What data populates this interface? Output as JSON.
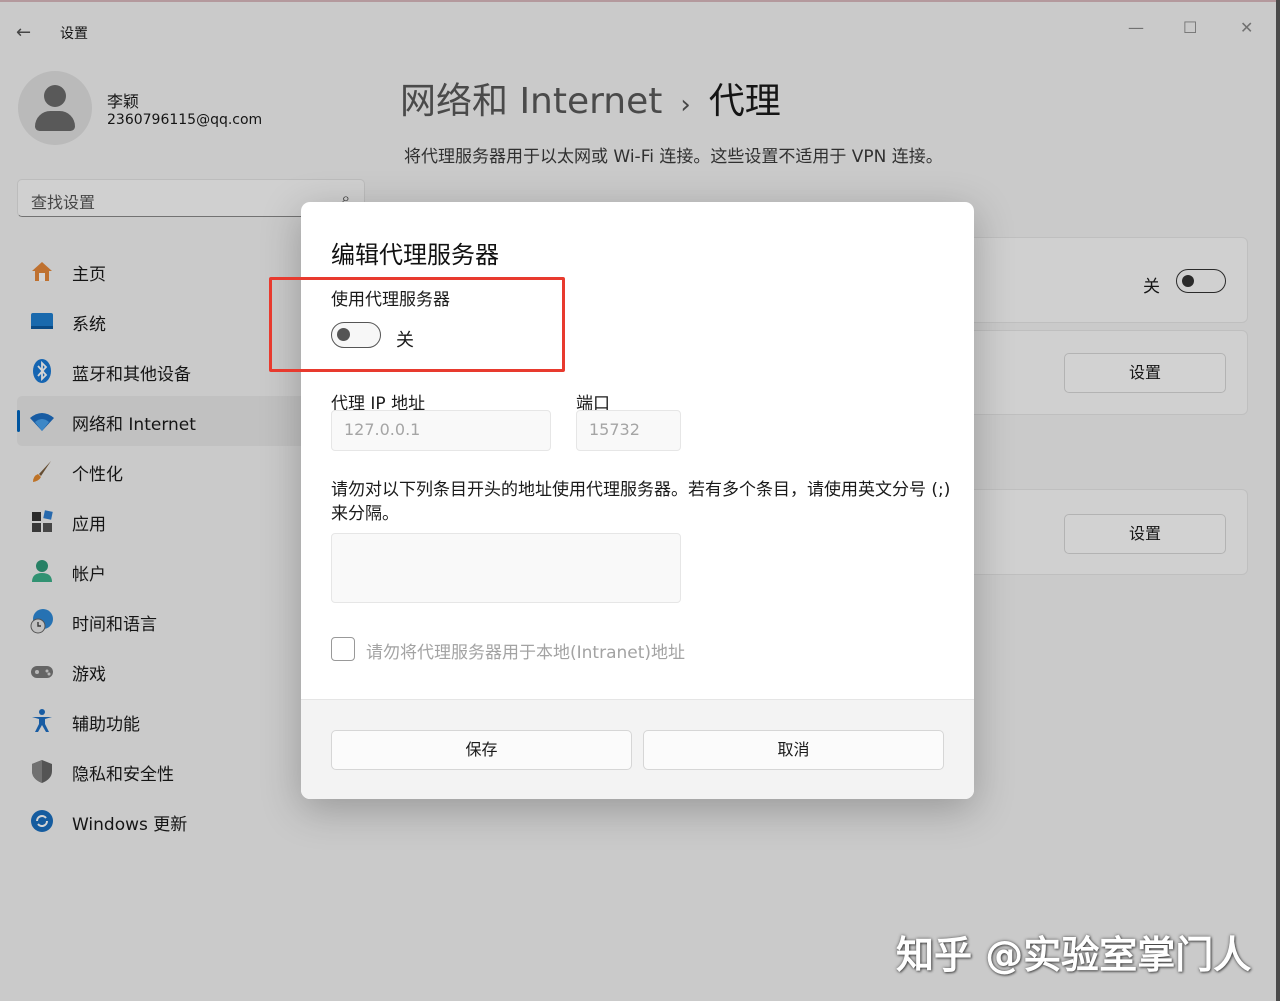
{
  "window": {
    "title": "设置",
    "back_icon": "←",
    "minimize": "—",
    "maximize": "☐",
    "close": "✕"
  },
  "profile": {
    "name": "李颖",
    "email": "2360796115@qq.com"
  },
  "search": {
    "placeholder": "查找设置",
    "icon": "⌕"
  },
  "nav": {
    "items": [
      {
        "label": "主页",
        "icon": "home-icon"
      },
      {
        "label": "系统",
        "icon": "system-icon"
      },
      {
        "label": "蓝牙和其他设备",
        "icon": "bluetooth-icon"
      },
      {
        "label": "网络和 Internet",
        "icon": "wifi-icon",
        "selected": true
      },
      {
        "label": "个性化",
        "icon": "brush-icon"
      },
      {
        "label": "应用",
        "icon": "apps-icon"
      },
      {
        "label": "帐户",
        "icon": "account-icon"
      },
      {
        "label": "时间和语言",
        "icon": "time-language-icon"
      },
      {
        "label": "游戏",
        "icon": "gamepad-icon"
      },
      {
        "label": "辅助功能",
        "icon": "accessibility-icon"
      },
      {
        "label": "隐私和安全性",
        "icon": "shield-icon"
      },
      {
        "label": "Windows 更新",
        "icon": "update-icon"
      }
    ]
  },
  "main": {
    "breadcrumb_parent": "网络和 Internet",
    "breadcrumb_sep": "›",
    "breadcrumb_current": "代理",
    "description": "将代理服务器用于以太网或 Wi-Fi 连接。这些设置不适用于 VPN 连接。",
    "auto_detect_state": "关",
    "setup_button_1": "设置",
    "setup_button_2": "设置"
  },
  "dialog": {
    "title": "编辑代理服务器",
    "use_proxy_label": "使用代理服务器",
    "use_proxy_state": "关",
    "use_proxy_on": false,
    "ip_label": "代理 IP 地址",
    "ip_value": "127.0.0.1",
    "port_label": "端口",
    "port_value": "15732",
    "exceptions_label": "请勿对以下列条目开头的地址使用代理服务器。若有多个条目，请使用英文分号 (;) 来分隔。",
    "exceptions_value": "",
    "local_checkbox_label": "请勿将代理服务器用于本地(Intranet)地址",
    "local_checkbox_checked": false,
    "save_button": "保存",
    "cancel_button": "取消"
  },
  "annotation": {
    "color": "#e83a2e"
  },
  "watermark": "知乎 @实验室掌门人",
  "colors": {
    "accent": "#0067c0"
  }
}
